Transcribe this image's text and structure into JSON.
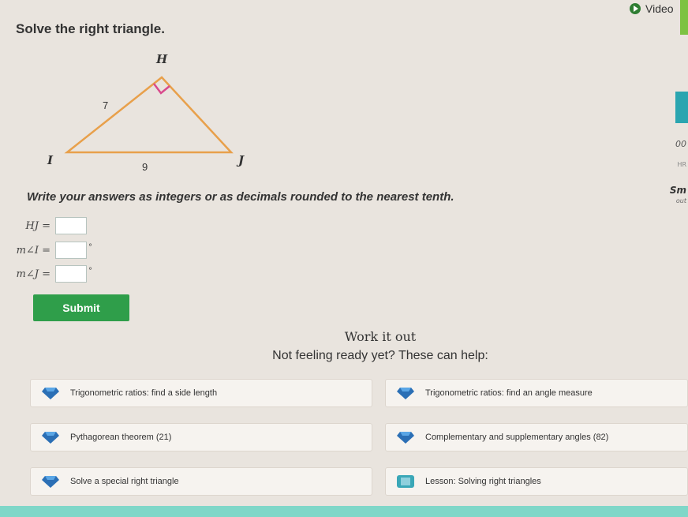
{
  "header": {
    "video_label": "Video"
  },
  "problem": {
    "title": "Solve the right triangle.",
    "triangle": {
      "vertices": {
        "H": "H",
        "I": "I",
        "J": "J"
      },
      "side_HI": "7",
      "side_IJ": "9"
    },
    "instructions": "Write your answers as integers or as decimals rounded to the nearest tenth.",
    "answers": [
      {
        "label": "HJ =",
        "value": "",
        "degree": ""
      },
      {
        "label": "m∠I =",
        "value": "",
        "degree": "°"
      },
      {
        "label": "m∠J =",
        "value": "",
        "degree": "°"
      }
    ],
    "submit_label": "Submit"
  },
  "help": {
    "work_it_out": "Work it out",
    "not_ready": "Not feeling ready yet? These can help:",
    "resources": [
      {
        "name": "Trigonometric ratios: find a side length",
        "icon": "gem-icon"
      },
      {
        "name": "Trigonometric ratios: find an angle measure",
        "icon": "gem-icon"
      },
      {
        "name": "Pythagorean theorem (21)",
        "icon": "gem-icon"
      },
      {
        "name": "Complementary and supplementary angles (82)",
        "icon": "gem-icon"
      },
      {
        "name": "Solve a special right triangle",
        "icon": "gem-icon"
      },
      {
        "name": "Lesson: Solving right triangles",
        "icon": "lesson-icon"
      }
    ]
  },
  "sidebar_fragments": {
    "a": "00",
    "b": "HR",
    "c": "Sm",
    "d": "out"
  },
  "colors": {
    "triangle_stroke": "#e8a04b",
    "right_angle_marker": "#d94a8c",
    "submit": "#2f9e4a"
  }
}
